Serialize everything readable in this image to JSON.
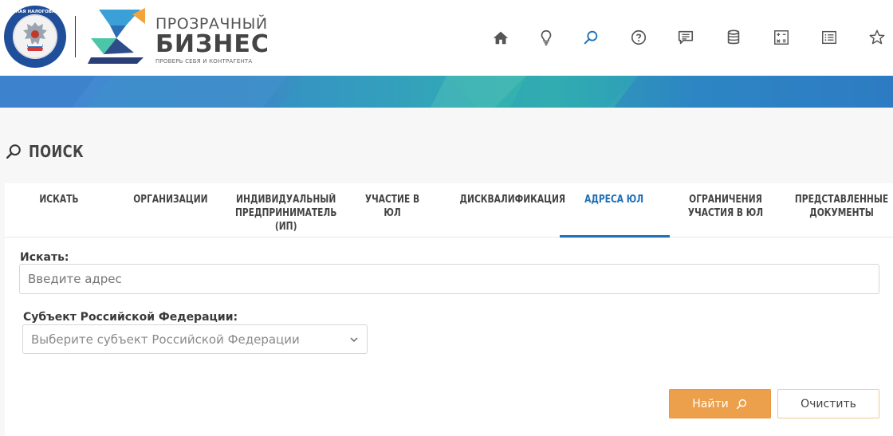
{
  "header": {
    "brand_top": "ПРОЗРАЧНЫЙ",
    "brand_main": "БИЗНЕС",
    "brand_sub": "ПРОВЕРЬ СЕБЯ И КОНТРАГЕНТА",
    "nav_icons": [
      "home-icon",
      "lightbulb-icon",
      "search-icon",
      "help-icon",
      "chat-icon",
      "database-icon",
      "calculator-icon",
      "list-icon",
      "star-icon"
    ],
    "active_icon": "search-icon"
  },
  "page": {
    "title": "ПОИСК"
  },
  "tabs": [
    {
      "label": "ИСКАТЬ",
      "active": false
    },
    {
      "label": "ОРГАНИЗАЦИИ",
      "active": false
    },
    {
      "label": "ИНДИВИДУАЛЬНЫЙ ПРЕДПРИНИМАТЕЛЬ (ИП)",
      "active": false
    },
    {
      "label": "УЧАСТИЕ В ЮЛ",
      "active": false
    },
    {
      "label": "ДИСКВАЛИФИКАЦИЯ",
      "active": false
    },
    {
      "label": "АДРЕСА ЮЛ",
      "active": true
    },
    {
      "label": "ОГРАНИЧЕНИЯ УЧАСТИЯ В ЮЛ",
      "active": false
    },
    {
      "label": "ПРЕДСТАВЛЕННЫЕ ДОКУМЕНТЫ",
      "active": false
    }
  ],
  "form": {
    "search_label": "Искать:",
    "search_placeholder": "Введите адрес",
    "search_value": "",
    "region_label": "Субъект Российской Федерации:",
    "region_selected": "Выберите субъект Российской Федерации",
    "find_button": "Найти",
    "clear_button": "Очистить"
  },
  "colors": {
    "accent": "#1e6fb6",
    "primary_button": "#eda04b",
    "banner_blue": "#3a87c8",
    "banner_teal": "#36b5ad"
  }
}
